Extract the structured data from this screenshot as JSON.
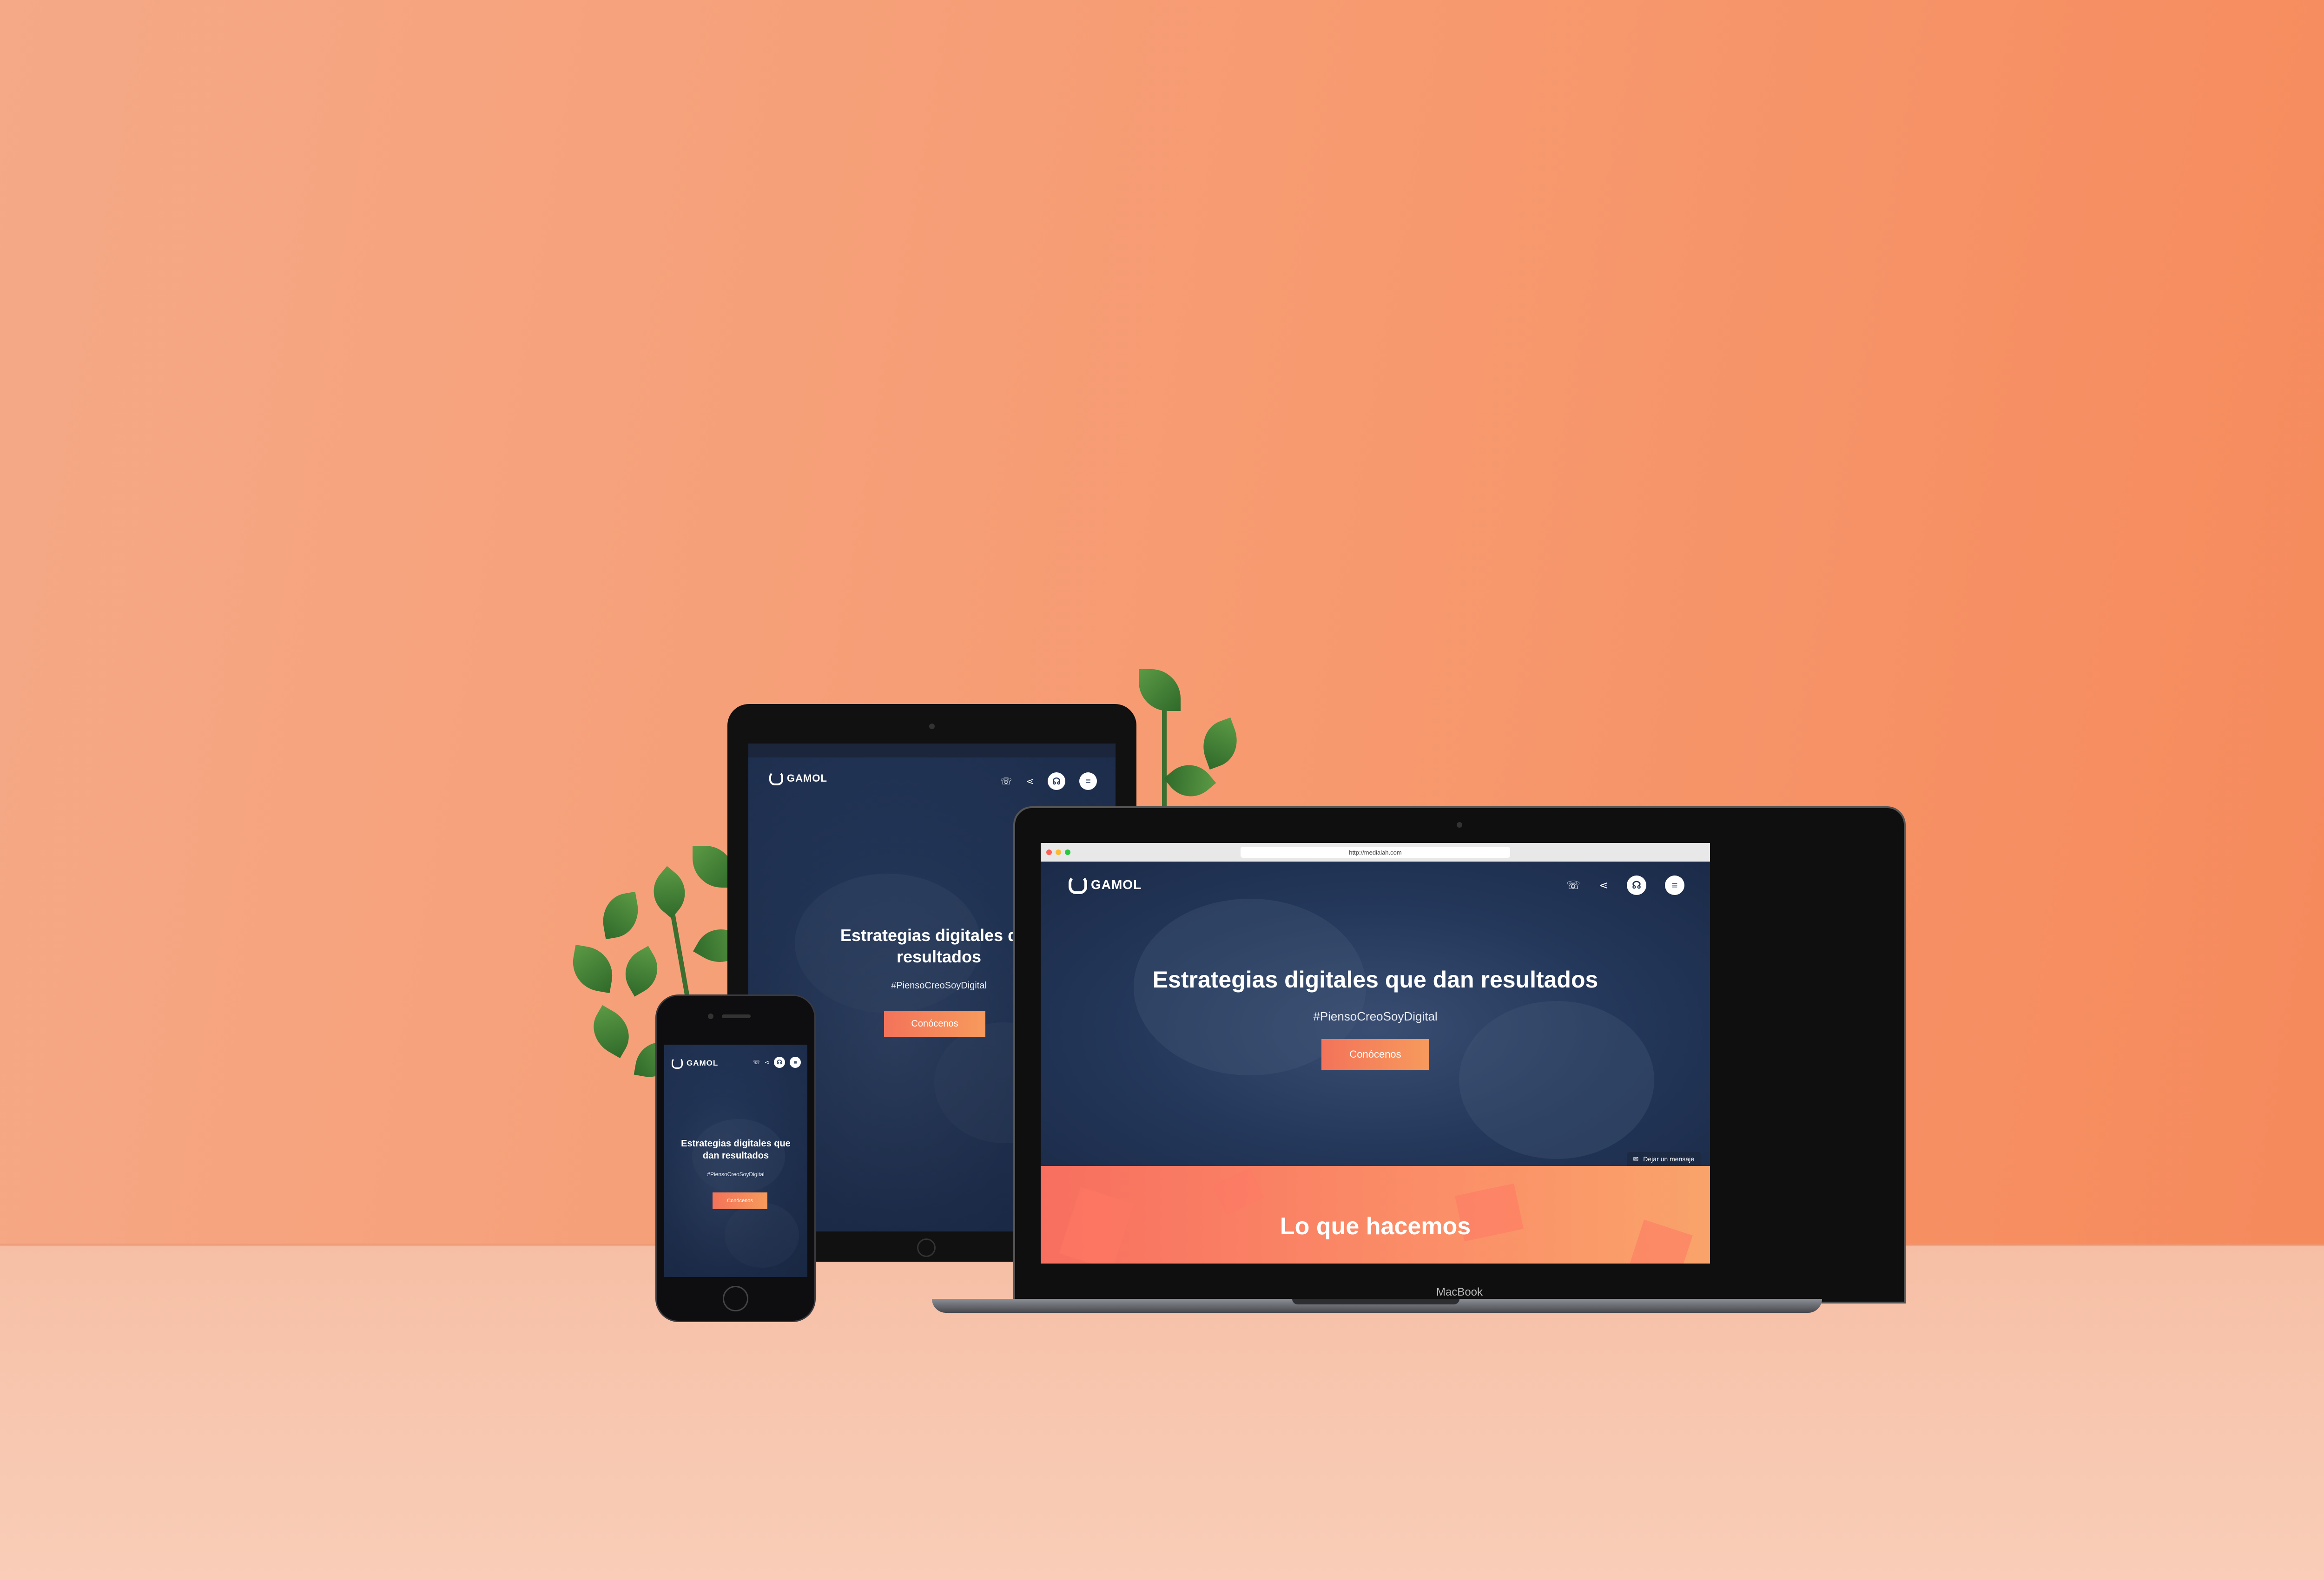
{
  "scene": {
    "wall_color": "#f79a70",
    "floor_color": "#f8c8b1"
  },
  "brand": {
    "name": "GAMOL"
  },
  "hero": {
    "headline": "Estrategias digitales que dan resultados",
    "headline_tablet_line1": "Estrategias digitales que",
    "headline_tablet_line2": "resultados",
    "headline_phone_line1": "Estrategias digitales que",
    "headline_phone_line2": "dan resultados",
    "hashtag": "#PiensoCreoSoyDigital",
    "cta_label": "Conócenos"
  },
  "nav_icons": [
    "phone-icon",
    "share-icon",
    "headset-icon",
    "menu-icon"
  ],
  "browser": {
    "url": "http://medialah.com"
  },
  "chat": {
    "label": "Dejar un mensaje"
  },
  "section2": {
    "title": "Lo que hacemos"
  },
  "laptop": {
    "model_label": "MacBook"
  },
  "colors": {
    "accent": "#f3735a",
    "navy": "#24385b"
  }
}
